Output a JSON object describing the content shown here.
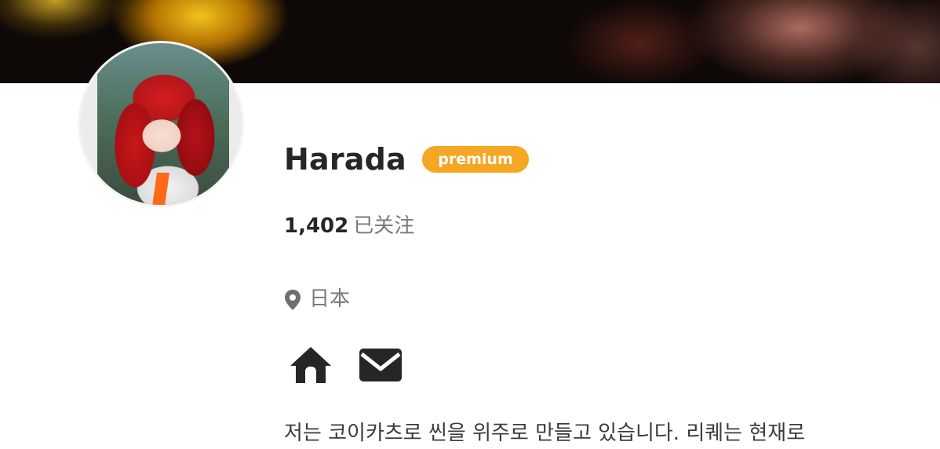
{
  "profile": {
    "name": "Harada",
    "badge": "premium",
    "following_count": "1,402",
    "following_label": "已关注",
    "location": "日本",
    "bio": "저는 코이카츠로 씬을 위주로 만들고 있습니다. 리퀘는 현재로"
  },
  "icons": {
    "location": "map-pin-icon",
    "home": "home-icon",
    "mail": "mail-icon"
  },
  "colors": {
    "badge": "#f5a623",
    "text": "#262626",
    "muted": "#7a7a7a"
  }
}
